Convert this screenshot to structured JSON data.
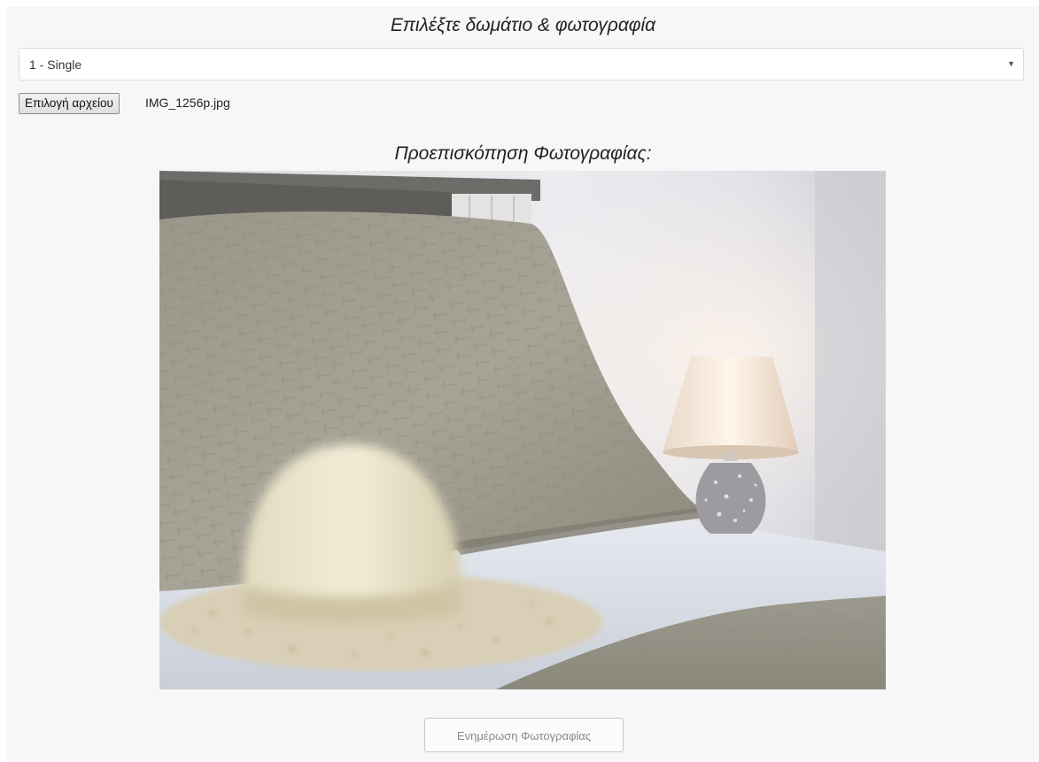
{
  "page_title": "Επιλέξτε δωμάτιο & φωτογραφία",
  "room_select": {
    "selected": "1 - Single",
    "arrow_icon": "caret-down-icon"
  },
  "file_input": {
    "button_label": "Επιλογή αρχείου",
    "file_name": "IMG_1256p.jpg"
  },
  "preview_title": "Προεπισκόπηση Φωτογραφίας:",
  "update_button_label": "Ενημέρωση Φωτογραφίας",
  "colors": {
    "page_background": "#f7f7f7",
    "button_text_disabled": "#8a8a8a"
  }
}
